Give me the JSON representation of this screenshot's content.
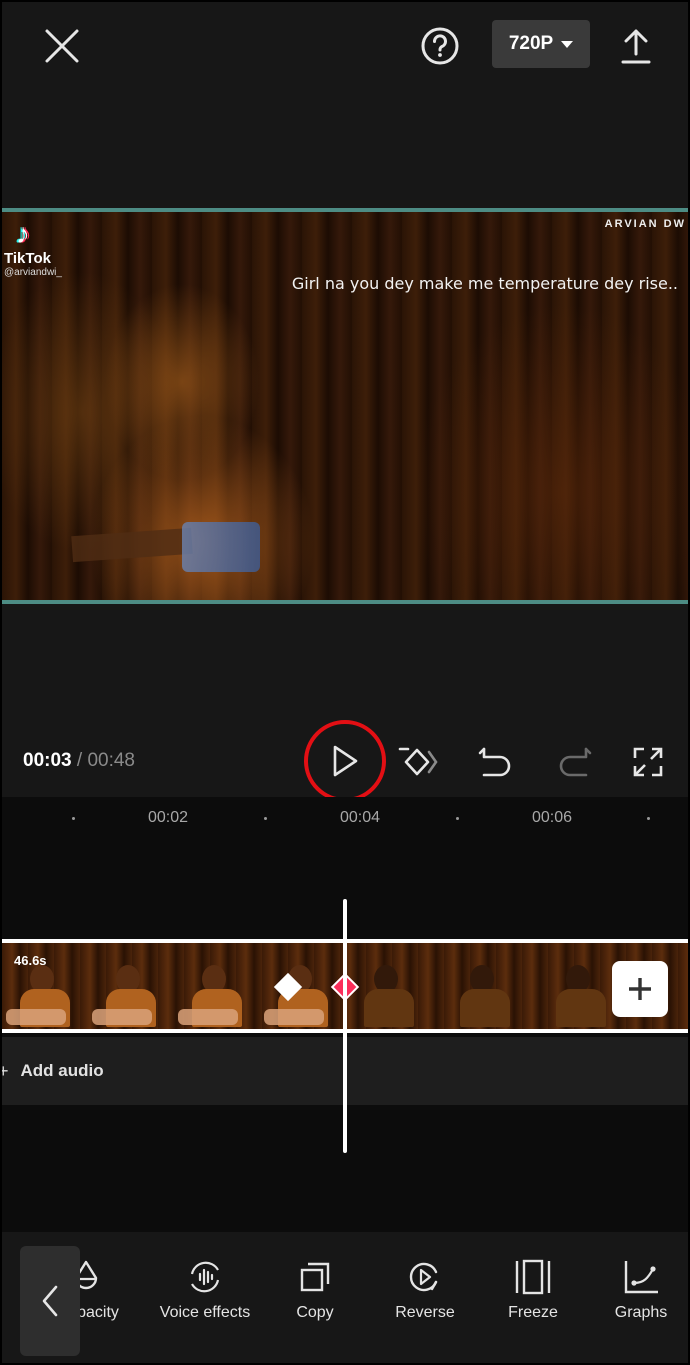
{
  "topbar": {
    "close_icon": "close-icon",
    "help_icon": "help-icon",
    "resolution": "720P",
    "export_icon": "upload-icon"
  },
  "preview": {
    "tiktok_brand": "TikTok",
    "tiktok_handle": "@arviandwi_",
    "watermark": "ARVIAN DW",
    "lyric": "Girl na you dey make me temperature dey rise.."
  },
  "playback": {
    "current_time": "00:03",
    "separator": "/",
    "total_time": "00:48",
    "accent_color": "#e30f14"
  },
  "timeline": {
    "ruler_labels": [
      "00:02",
      "00:04",
      "00:06"
    ],
    "clip_duration": "46.6s",
    "add_audio_label": "Add audio",
    "keyframe_color": "#fb2d5a"
  },
  "toolbar": {
    "items": [
      {
        "label": "Opacity",
        "visible_label": "pacity",
        "icon": "opacity-icon"
      },
      {
        "label": "Voice effects",
        "icon": "voice-effects-icon"
      },
      {
        "label": "Copy",
        "icon": "copy-icon"
      },
      {
        "label": "Reverse",
        "icon": "reverse-icon"
      },
      {
        "label": "Freeze",
        "icon": "freeze-icon"
      },
      {
        "label": "Graphs",
        "icon": "graphs-icon"
      }
    ]
  }
}
